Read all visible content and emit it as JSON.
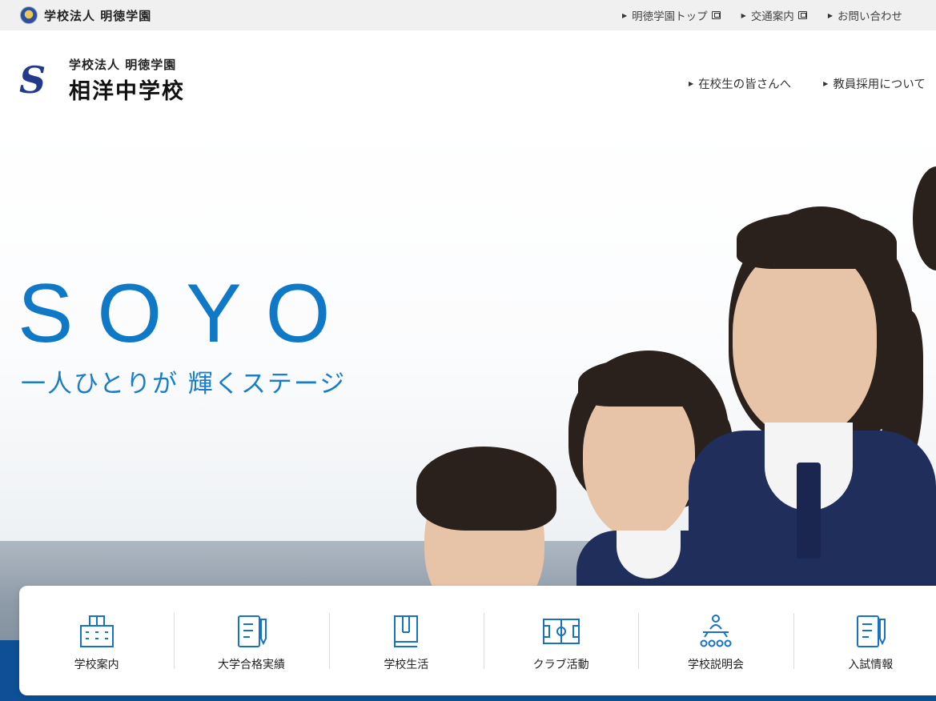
{
  "topbar": {
    "org_name": "学校法人 明徳学園",
    "links": [
      {
        "label": "明徳学園トップ",
        "icon": "external-link-icon"
      },
      {
        "label": "交通案内",
        "icon": "external-link-icon"
      },
      {
        "label": "お問い合わせ",
        "icon": "external-link-icon"
      }
    ]
  },
  "header": {
    "logo_sub": "学校法人 明徳学園",
    "logo_main": "相洋中学校",
    "nav": [
      {
        "label": "在校生の皆さんへ"
      },
      {
        "label": "教員採用について"
      }
    ]
  },
  "hero": {
    "title": "SOYO",
    "tagline": "一人ひとりが 輝くステージ"
  },
  "menu": [
    {
      "label": "学校案内",
      "icon": "school-building-icon"
    },
    {
      "label": "大学合格実績",
      "icon": "document-pen-icon"
    },
    {
      "label": "学校生活",
      "icon": "book-icon"
    },
    {
      "label": "クラブ活動",
      "icon": "sports-field-icon"
    },
    {
      "label": "学校説明会",
      "icon": "presentation-audience-icon"
    },
    {
      "label": "入試情報",
      "icon": "exam-document-icon"
    }
  ],
  "colors": {
    "accent": "#0f79c8",
    "bar": "#0e4f96",
    "topbar_bg": "#f0f0f0"
  }
}
